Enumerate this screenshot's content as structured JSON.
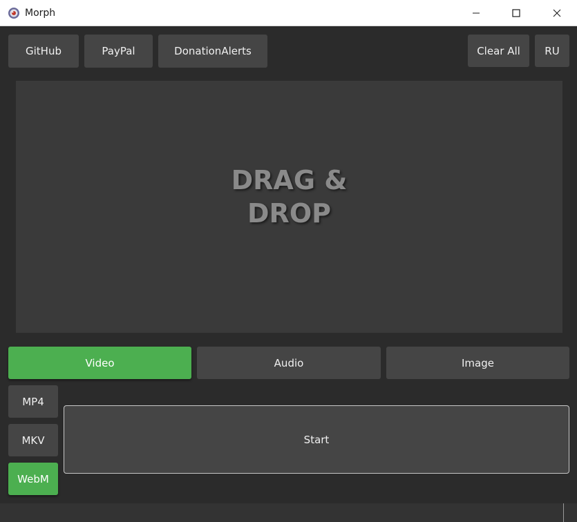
{
  "window": {
    "title": "Morph"
  },
  "toolbar": {
    "github_label": "GitHub",
    "paypal_label": "PayPal",
    "donationalerts_label": "DonationAlerts",
    "clear_all_label": "Clear All",
    "language_label": "RU"
  },
  "dropzone": {
    "text": "DRAG & DROP"
  },
  "media_tabs": {
    "video_label": "Video",
    "audio_label": "Audio",
    "image_label": "Image",
    "selected": "Video"
  },
  "formats": {
    "mp4_label": "MP4",
    "mkv_label": "MKV",
    "webm_label": "WebM",
    "selected": "WebM"
  },
  "actions": {
    "start_label": "Start"
  },
  "colors": {
    "accent": "#4caf50",
    "background": "#2b2b2b",
    "button": "#454545",
    "dropzone": "#3a3a3a"
  },
  "icons": {
    "app": "morph-app-icon",
    "minimize": "minimize-icon",
    "maximize": "maximize-icon",
    "close": "close-icon"
  }
}
